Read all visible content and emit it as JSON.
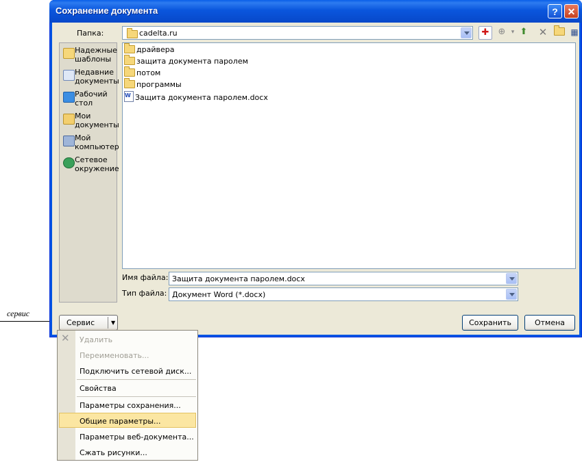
{
  "window": {
    "title": "Сохранение документа",
    "help_glyph": "?",
    "close_glyph": "✕"
  },
  "folder_bar": {
    "label": "Папка:",
    "value": "cadelta.ru"
  },
  "places": [
    {
      "line1": "Надежные",
      "line2": "шаблоны",
      "icon": "folder-icon",
      "color": "#f6d77a"
    },
    {
      "line1": "Недавние",
      "line2": "документы",
      "icon": "recent-icon",
      "color": "#8fb3e6"
    },
    {
      "line1": "Рабочий",
      "line2": "стол",
      "icon": "desktop-icon",
      "color": "#3b8ee3"
    },
    {
      "line1": "Мои",
      "line2": "документы",
      "icon": "my-documents-icon",
      "color": "#f3cf6e"
    },
    {
      "line1": "Мой",
      "line2": "компьютер",
      "icon": "my-computer-icon",
      "color": "#7d9ac7"
    },
    {
      "line1": "Сетевое",
      "line2": "окружение",
      "icon": "network-icon",
      "color": "#3aa05a"
    }
  ],
  "files": [
    {
      "name": "драйвера",
      "type": "folder"
    },
    {
      "name": "защита документа паролем",
      "type": "folder"
    },
    {
      "name": "потом",
      "type": "folder"
    },
    {
      "name": "программы",
      "type": "folder"
    },
    {
      "name": "Защита документа паролем.docx",
      "type": "doc"
    }
  ],
  "filename": {
    "label": "Имя файла:",
    "value": "Защита документа паролем.docx"
  },
  "filetype": {
    "label": "Тип файла:",
    "value": "Документ Word (*.docx)"
  },
  "buttons": {
    "tools": "Сервис",
    "save": "Сохранить",
    "cancel": "Отмена"
  },
  "callout": "сервис",
  "menu": {
    "items": [
      {
        "label": "Удалить",
        "disabled": true
      },
      {
        "label": "Переименовать...",
        "disabled": true
      },
      {
        "label": "Подключить сетевой диск...",
        "disabled": false
      },
      {
        "label": "Свойства",
        "disabled": false
      },
      {
        "label": "Параметры сохранения...",
        "disabled": false
      },
      {
        "label": "Общие параметры...",
        "disabled": false,
        "highlighted": true
      },
      {
        "label": "Параметры веб-документа...",
        "disabled": false
      },
      {
        "label": "Сжать рисунки...",
        "disabled": false
      }
    ]
  }
}
